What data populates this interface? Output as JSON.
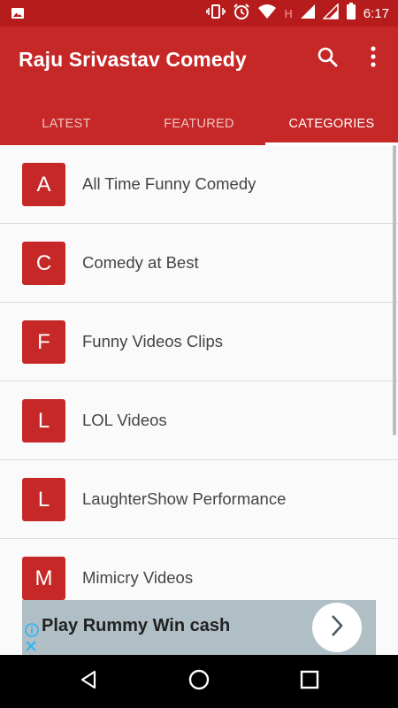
{
  "status_bar": {
    "time": "6:17",
    "indicator_letter": "H",
    "icons": [
      "image-icon",
      "vibrate-icon",
      "alarm-icon",
      "wifi-icon",
      "signal-icon",
      "signal-icon",
      "battery-icon"
    ]
  },
  "app_bar": {
    "title": "Raju Srivastav Comedy",
    "actions": [
      "search-icon",
      "more-vert-icon"
    ]
  },
  "tabs": [
    {
      "label": "LATEST",
      "active": false
    },
    {
      "label": "FEATURED",
      "active": false
    },
    {
      "label": "CATEGORIES",
      "active": true
    }
  ],
  "categories": [
    {
      "letter": "A",
      "label": "All Time Funny Comedy"
    },
    {
      "letter": "C",
      "label": "Comedy at Best"
    },
    {
      "letter": "F",
      "label": "Funny Videos Clips"
    },
    {
      "letter": "L",
      "label": "LOL Videos"
    },
    {
      "letter": "L",
      "label": "LaughterShow Performance"
    },
    {
      "letter": "M",
      "label": "Mimicry Videos"
    }
  ],
  "ad": {
    "text": "Play Rummy Win cash",
    "icons": [
      "info-icon",
      "close-icon",
      "chevron-right-icon"
    ]
  },
  "nav_bar": {
    "buttons": [
      "back-icon",
      "home-icon",
      "recents-icon"
    ]
  },
  "colors": {
    "primary": "#c62828",
    "primary_dark": "#b71c1c",
    "ad_background": "#b0bec5"
  }
}
